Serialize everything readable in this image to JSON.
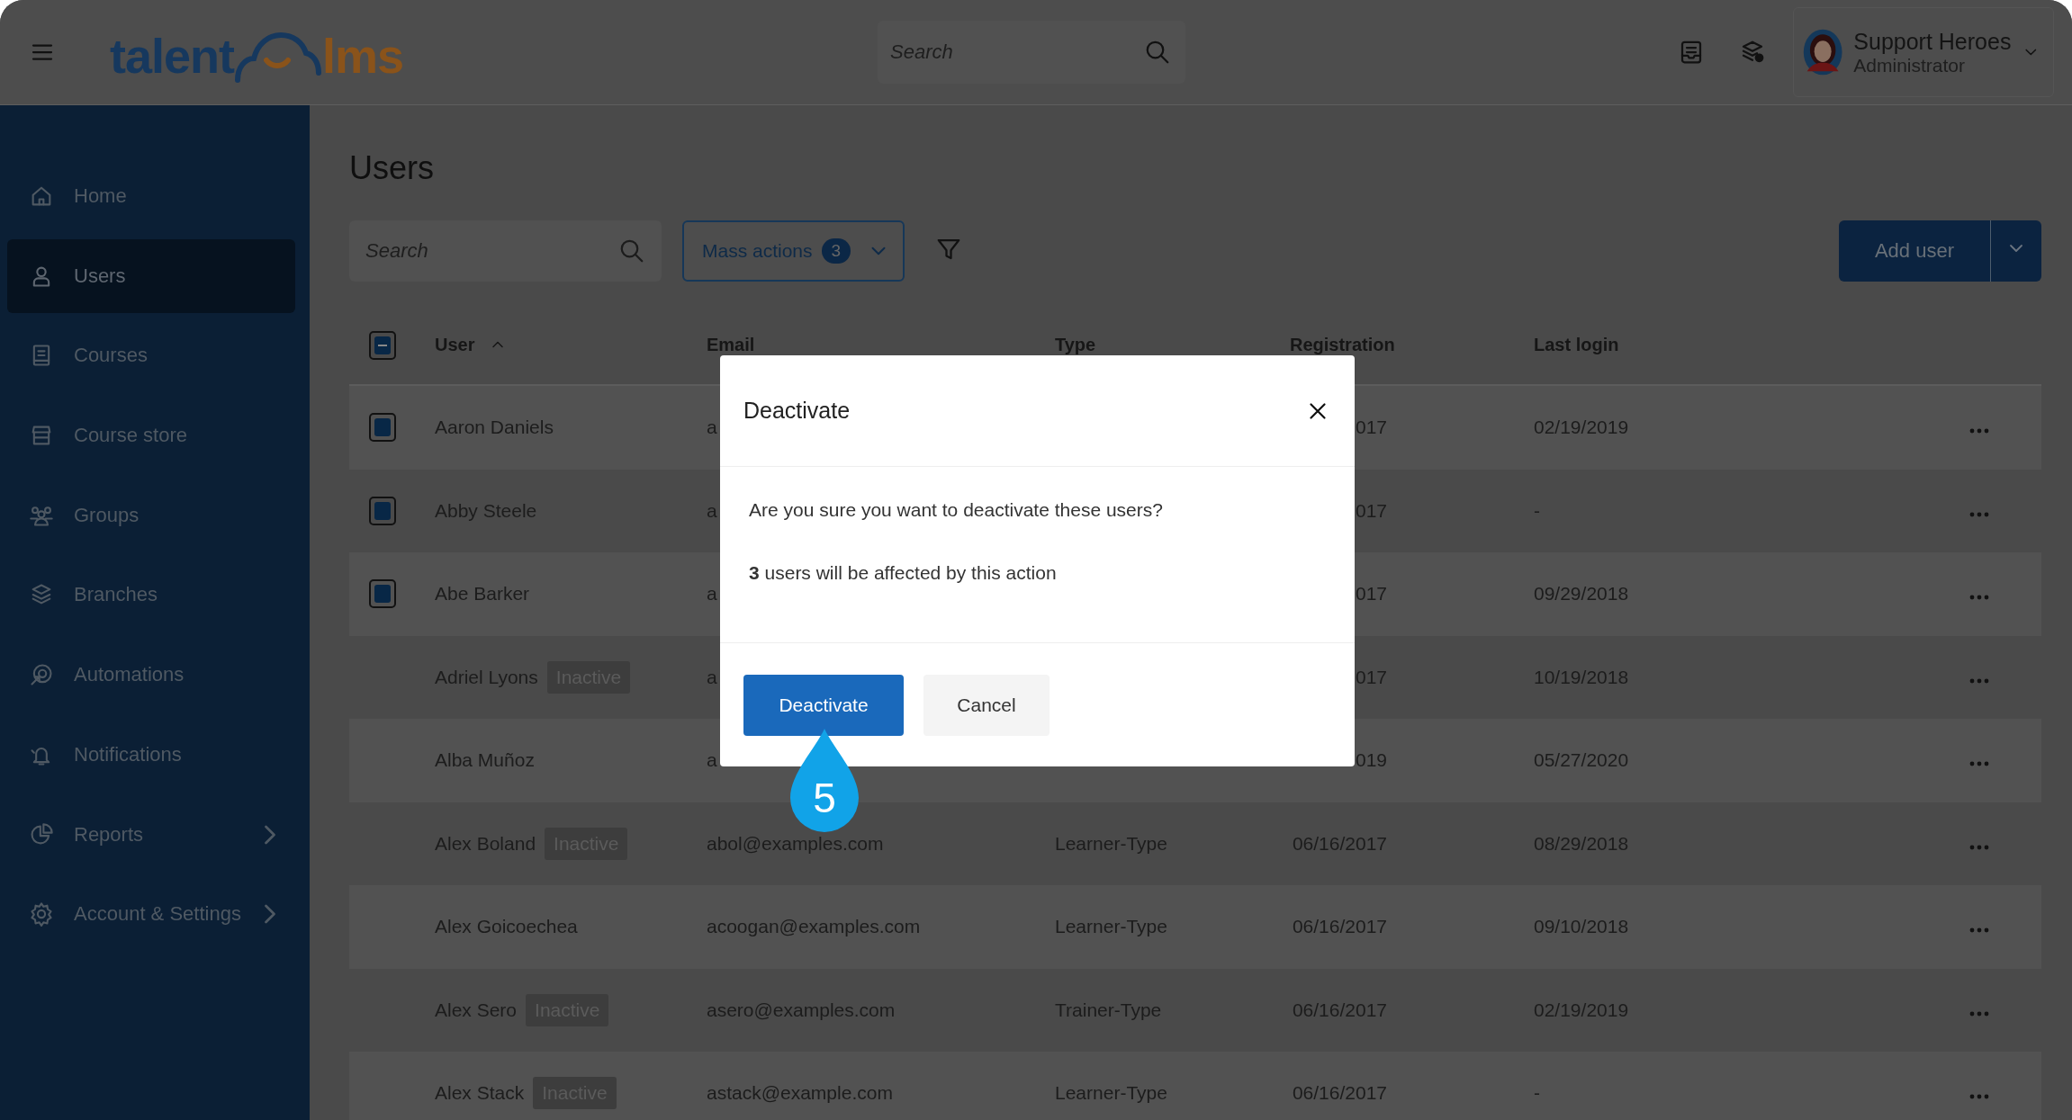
{
  "topbar": {
    "logo": {
      "word_1": "talent",
      "word_2": "lms"
    },
    "search": {
      "placeholder": "Search"
    },
    "user": {
      "name": "Support Heroes",
      "role": "Administrator"
    }
  },
  "sidebar": {
    "items": [
      {
        "label": "Home",
        "selected": false,
        "submenu": false
      },
      {
        "label": "Users",
        "selected": true,
        "submenu": false
      },
      {
        "label": "Courses",
        "selected": false,
        "submenu": false
      },
      {
        "label": "Course store",
        "selected": false,
        "submenu": false
      },
      {
        "label": "Groups",
        "selected": false,
        "submenu": false
      },
      {
        "label": "Branches",
        "selected": false,
        "submenu": false
      },
      {
        "label": "Automations",
        "selected": false,
        "submenu": false
      },
      {
        "label": "Notifications",
        "selected": false,
        "submenu": false
      },
      {
        "label": "Reports",
        "selected": false,
        "submenu": true
      },
      {
        "label": "Account & Settings",
        "selected": false,
        "submenu": true
      }
    ]
  },
  "page": {
    "title": "Users",
    "search": {
      "placeholder": "Search"
    },
    "mass_actions": {
      "label": "Mass actions",
      "count": "3"
    },
    "add_user": "Add user"
  },
  "table": {
    "select_all": {
      "checked": true,
      "indeterminate": true
    },
    "columns": [
      {
        "label": "User",
        "sorted": true
      },
      {
        "label": "Email",
        "sorted": false
      },
      {
        "label": "Type",
        "sorted": false
      },
      {
        "label": "Registration",
        "sorted": false
      },
      {
        "label": "Last login",
        "sorted": false
      }
    ],
    "rows": [
      {
        "checked": true,
        "user": "Aaron Daniels",
        "email": "a",
        "registration": "017",
        "last_login": "02/19/2019"
      },
      {
        "checked": true,
        "user": "Abby Steele",
        "email": "a",
        "registration": "017",
        "last_login": "-"
      },
      {
        "checked": true,
        "user": "Abe Barker",
        "email": "a",
        "registration": "017",
        "last_login": "09/29/2018"
      },
      {
        "checked": false,
        "user": "Adriel Lyons",
        "badge": "Inactive",
        "email": "a",
        "registration": "017",
        "last_login": "10/19/2018"
      },
      {
        "checked": false,
        "user": "Alba Muñoz",
        "email": "a",
        "registration": "019",
        "last_login": "05/27/2020"
      },
      {
        "checked": false,
        "user": "Alex Boland",
        "badge": "Inactive",
        "email": "abol@examples.com",
        "type": "Learner-Type",
        "registration": "06/16/2017",
        "last_login": "08/29/2018"
      },
      {
        "checked": false,
        "user": "Alex Goicoechea",
        "email": "acoogan@examples.com",
        "type": "Learner-Type",
        "registration": "06/16/2017",
        "last_login": "09/10/2018"
      },
      {
        "checked": false,
        "user": "Alex Sero",
        "badge": "Inactive",
        "email": "asero@examples.com",
        "type": "Trainer-Type",
        "registration": "06/16/2017",
        "last_login": "02/19/2019"
      },
      {
        "checked": false,
        "user": "Alex Stack",
        "badge": "Inactive",
        "email": "astack@example.com",
        "type": "Learner-Type",
        "registration": "06/16/2017",
        "last_login": "-"
      }
    ]
  },
  "modal": {
    "title": "Deactivate",
    "question": "Are you sure you want to deactivate these users?",
    "note": "**3** users will be affected by this action",
    "buttons": [
      {
        "label": "Deactivate",
        "kind": "primary"
      },
      {
        "label": "Cancel",
        "kind": "secondary"
      }
    ]
  },
  "step_marker": "5"
}
